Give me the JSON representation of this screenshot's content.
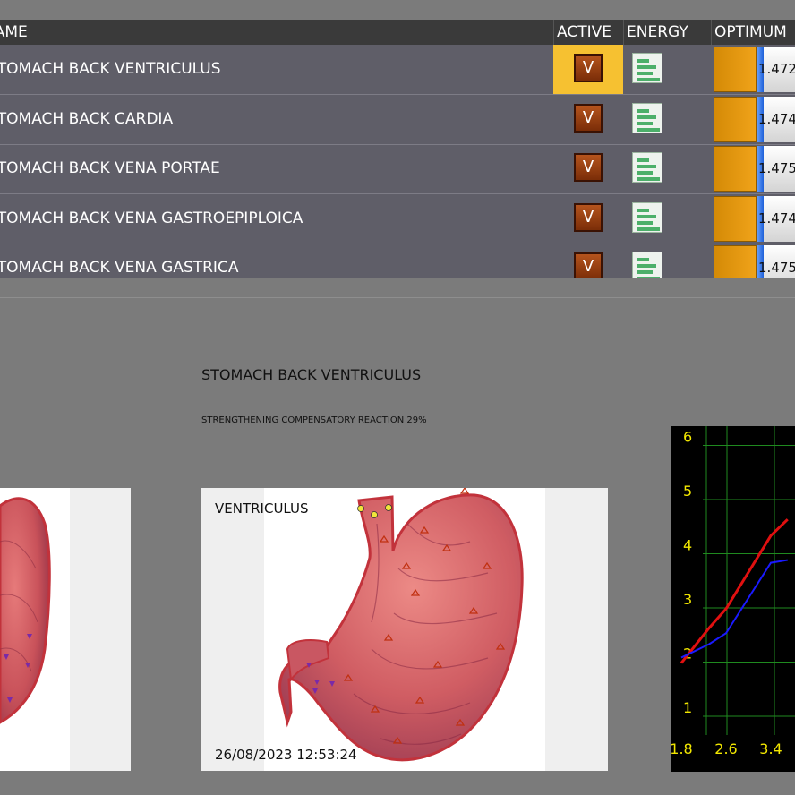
{
  "table": {
    "headers": {
      "name": "NAME",
      "active": "ACTIVE",
      "energy": "ENERGY",
      "optimum": "OPTIMUM"
    },
    "rows": [
      {
        "name": "STOMACH BACK VENTRICULUS",
        "active": "V",
        "optimum": "1.472",
        "selected": true
      },
      {
        "name": "STOMACH BACK CARDIA",
        "active": "V",
        "optimum": "1.474"
      },
      {
        "name": "STOMACH BACK VENA  PORTAE",
        "active": "V",
        "optimum": "1.475"
      },
      {
        "name": "STOMACH BACK VENA  GASTROEPIPLOICA",
        "active": "V",
        "optimum": "1.474"
      },
      {
        "name": "STOMACH BACK VENA  GASTRICA",
        "active": "V",
        "optimum": "1.475"
      }
    ]
  },
  "detail": {
    "title": "STOMACH BACK VENTRICULUS",
    "subtitle": "STRENGTHENING COMPENSATORY REACTION 29%",
    "image_label": "VENTRICULUS",
    "timestamp": "26/08/2023 12:53:24"
  },
  "colors": {
    "selected_row": "#f6c131",
    "red_series": "#e01010",
    "blue_series": "#1a1aff",
    "axis_text": "#f2e700",
    "grid": "#1f8a1f"
  },
  "chart_data": {
    "type": "line",
    "x_ticks": [
      "1.8",
      "2.6",
      "3.4"
    ],
    "y_ticks": [
      "1",
      "2",
      "3",
      "4",
      "5",
      "6"
    ],
    "ylim": [
      1,
      6
    ],
    "series": [
      {
        "color": "red",
        "x": [
          1.8,
          2.3,
          2.6,
          3.4,
          3.7
        ],
        "y": [
          1.95,
          2.6,
          2.95,
          4.3,
          4.6
        ]
      },
      {
        "color": "blue",
        "x": [
          1.8,
          2.3,
          2.6,
          3.4,
          3.7
        ],
        "y": [
          2.05,
          2.3,
          2.5,
          3.8,
          3.85
        ]
      }
    ]
  }
}
